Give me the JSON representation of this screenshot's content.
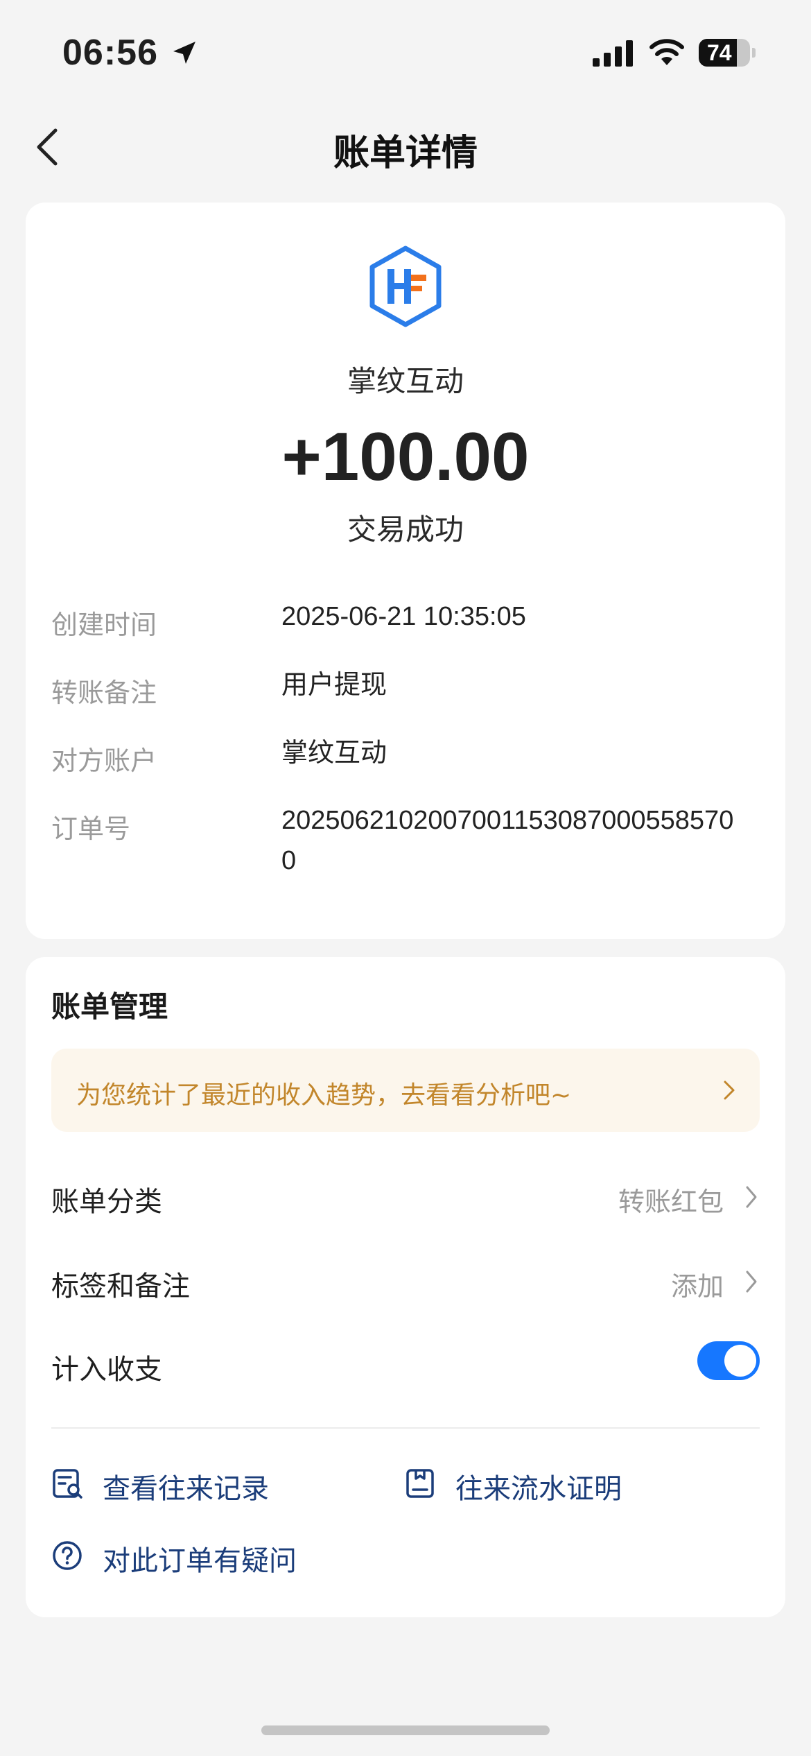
{
  "status_bar": {
    "time": "06:56",
    "battery": "74",
    "battery_level": 0.74
  },
  "nav": {
    "title": "账单详情"
  },
  "transaction": {
    "merchant": "掌纹互动",
    "amount": "+100.00",
    "status": "交易成功",
    "details": [
      {
        "label": "创建时间",
        "value": "2025-06-21 10:35:05"
      },
      {
        "label": "转账备注",
        "value": "用户提现"
      },
      {
        "label": "对方账户",
        "value": "掌纹互动"
      },
      {
        "label": "订单号",
        "value": "20250621020070011530870005585700"
      }
    ]
  },
  "manage": {
    "title": "账单管理",
    "promo": "为您统计了最近的收入趋势，去看看分析吧~",
    "category_label": "账单分类",
    "category_value": "转账红包",
    "tags_label": "标签和备注",
    "tags_value": "添加",
    "include_label": "计入收支",
    "include_on": true,
    "links": {
      "records": "查看往来记录",
      "proof": "往来流水证明",
      "question": "对此订单有疑问"
    }
  },
  "colors": {
    "accent": "#1677ff",
    "link": "#1b3d7a",
    "promo_text": "#c2862b",
    "promo_bg": "#fcf6ec"
  }
}
